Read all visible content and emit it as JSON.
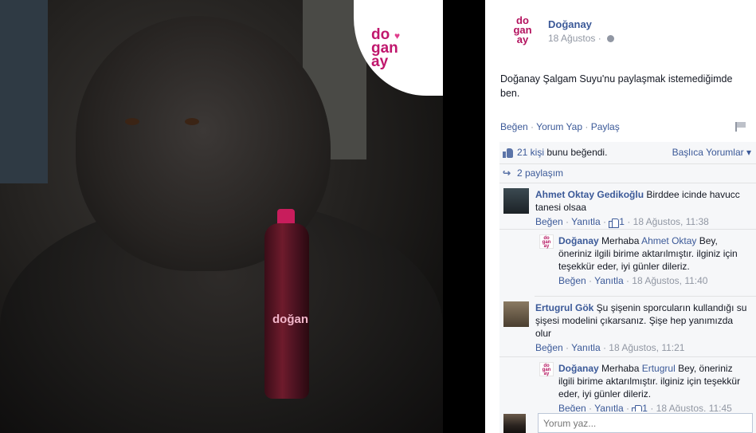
{
  "photo": {
    "logo_lines": [
      "do",
      "gan",
      "ay"
    ],
    "bottle_label": "doğan",
    "colors": {
      "brand": "#c0176d",
      "brand_light": "#e03c8c",
      "bottle_cap": "#c81d5c"
    }
  },
  "post": {
    "page_name": "Doğanay",
    "date": "18 Ağustos",
    "privacy_icon": "globe-icon",
    "text": "Doğanay Şalgam Suyu'nu paylaşmak istemediğimde ben.",
    "actions": {
      "like": "Beğen",
      "comment": "Yorum Yap",
      "share": "Paylaş",
      "separator": " · "
    }
  },
  "ufi": {
    "likes_count_text": "21 kişi",
    "likes_suffix": " bunu beğendi.",
    "sort_label": "Başlıca Yorumlar ▾",
    "shares_text": "2 paylaşım"
  },
  "comments": [
    {
      "author": "Ahmet Oktay Gedikoğlu",
      "text": " Birddee icinde havucc tanesi olsaa",
      "like": "Beğen",
      "reply": "Yanıtla",
      "like_count": "1",
      "time": "18 Ağustos, 11:38",
      "reply_item": {
        "author": "Doğanay",
        "text_prefix": " Merhaba ",
        "mention": "Ahmet Oktay",
        "text_suffix": " Bey, öneriniz ilgili birime aktarılmıştır. ilginiz için teşekkür eder, iyi günler dileriz.",
        "like": "Beğen",
        "reply": "Yanıtla",
        "time": "18 Ağustos, 11:40"
      }
    },
    {
      "author": "Ertugrul Gök",
      "text": " Şu şişenin sporcuların kullandığı su şişesi modelini çıkarsanız. Şişe hep yanımızda olur",
      "like": "Beğen",
      "reply": "Yanıtla",
      "time": "18 Ağustos, 11:21",
      "reply_item": {
        "author": "Doğanay",
        "text_prefix": " Merhaba ",
        "mention": "Ertugrul",
        "text_suffix": " Bey, öneriniz ilgili birime aktarılmıştır. ilginiz için teşekkür eder, iyi günler dileriz.",
        "like": "Beğen",
        "reply": "Yanıtla",
        "like_count": "1",
        "time": "18 Ağustos, 11:45"
      }
    }
  ],
  "composer": {
    "placeholder": "Yorum yaz..."
  }
}
